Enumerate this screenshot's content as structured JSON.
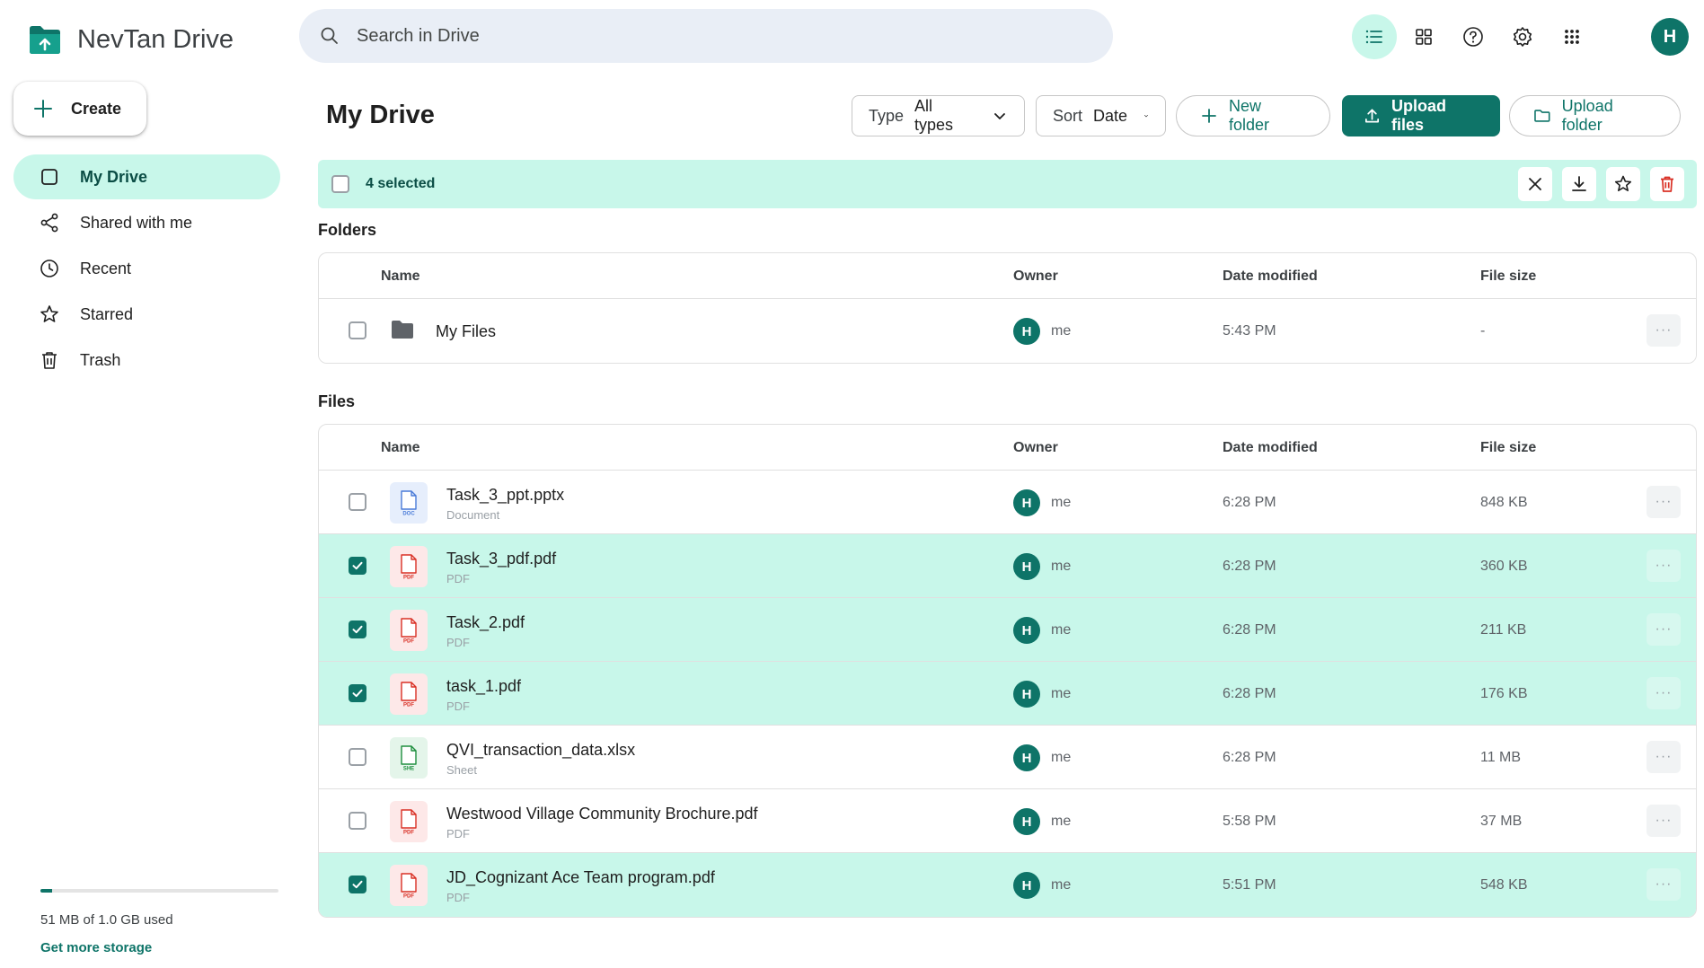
{
  "app": {
    "title": "NevTan Drive"
  },
  "sidebar": {
    "create_label": "Create",
    "items": [
      {
        "label": "My Drive",
        "icon": "drive-icon",
        "active": true
      },
      {
        "label": "Shared with me",
        "icon": "share-icon",
        "active": false
      },
      {
        "label": "Recent",
        "icon": "clock-icon",
        "active": false
      },
      {
        "label": "Starred",
        "icon": "star-icon",
        "active": false
      },
      {
        "label": "Trash",
        "icon": "trash-icon",
        "active": false
      }
    ],
    "storage": {
      "used_text": "51 MB of 1.0 GB used",
      "used_fraction": 0.05,
      "link": "Get more storage"
    }
  },
  "search": {
    "placeholder": "Search in Drive"
  },
  "topbar": {
    "avatar_initial": "H",
    "icons": [
      "list-view-icon",
      "grid-view-icon",
      "help-icon",
      "settings-icon",
      "apps-icon"
    ]
  },
  "main": {
    "title": "My Drive",
    "filters": [
      {
        "key": "Type",
        "value": "All types"
      },
      {
        "key": "Sort",
        "value": "Date"
      }
    ],
    "new_folder_label": "New folder",
    "upload_files_label": "Upload files",
    "upload_folder_label": "Upload folder",
    "selection": {
      "text": "4 selected"
    }
  },
  "columns": {
    "name": "Name",
    "owner": "Owner",
    "date": "Date modified",
    "size": "File size"
  },
  "folders_section": {
    "title": "Folders",
    "rows": [
      {
        "name": "My Files",
        "owner_initial": "H",
        "owner": "me",
        "date": "5:43 PM",
        "size": "-"
      }
    ]
  },
  "files_section": {
    "title": "Files",
    "rows": [
      {
        "name": "Task_3_ppt.pptx",
        "type": "Document",
        "kind": "doc",
        "badge": "DOC",
        "owner_initial": "H",
        "owner": "me",
        "date": "6:28 PM",
        "size": "848 KB",
        "selected": false
      },
      {
        "name": "Task_3_pdf.pdf",
        "type": "PDF",
        "kind": "pdf",
        "badge": "PDF",
        "owner_initial": "H",
        "owner": "me",
        "date": "6:28 PM",
        "size": "360 KB",
        "selected": true
      },
      {
        "name": "Task_2.pdf",
        "type": "PDF",
        "kind": "pdf",
        "badge": "PDF",
        "owner_initial": "H",
        "owner": "me",
        "date": "6:28 PM",
        "size": "211 KB",
        "selected": true
      },
      {
        "name": "task_1.pdf",
        "type": "PDF",
        "kind": "pdf",
        "badge": "PDF",
        "owner_initial": "H",
        "owner": "me",
        "date": "6:28 PM",
        "size": "176 KB",
        "selected": true
      },
      {
        "name": "QVI_transaction_data.xlsx",
        "type": "Sheet",
        "kind": "sheet",
        "badge": "SHE",
        "owner_initial": "H",
        "owner": "me",
        "date": "6:28 PM",
        "size": "11 MB",
        "selected": false
      },
      {
        "name": "Westwood Village Community Brochure.pdf",
        "type": "PDF",
        "kind": "pdf",
        "badge": "PDF",
        "owner_initial": "H",
        "owner": "me",
        "date": "5:58 PM",
        "size": "37 MB",
        "selected": false
      },
      {
        "name": "JD_Cognizant Ace Team program.pdf",
        "type": "PDF",
        "kind": "pdf",
        "badge": "PDF",
        "owner_initial": "H",
        "owner": "me",
        "date": "5:51 PM",
        "size": "548 KB",
        "selected": true
      }
    ]
  },
  "colors": {
    "accent": "#0e7468",
    "selection": "#c8f7ea",
    "pdf": "#d93025",
    "doc": "#4a7bd8",
    "sheet": "#1e8e3e"
  }
}
